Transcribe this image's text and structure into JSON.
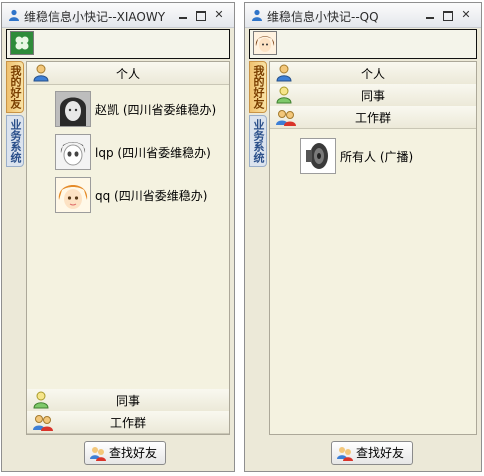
{
  "left_window": {
    "title": "维稳信息小快记--XIAOWY",
    "sidebar_tabs": [
      "我的好友",
      "业务系统"
    ],
    "groups": [
      {
        "label": "个人"
      },
      {
        "label": "同事"
      },
      {
        "label": "工作群"
      }
    ],
    "contacts": [
      {
        "name": "赵凯 (四川省委维稳办)"
      },
      {
        "name": "lqp (四川省委维稳办)"
      },
      {
        "name": "qq (四川省委维稳办)"
      }
    ],
    "find_button": "查找好友"
  },
  "right_window": {
    "title": "维稳信息小快记--QQ",
    "sidebar_tabs": [
      "我的好友",
      "业务系统"
    ],
    "groups": [
      {
        "label": "个人"
      },
      {
        "label": "同事"
      },
      {
        "label": "工作群"
      }
    ],
    "broadcast": {
      "name": "所有人 (广播)"
    },
    "find_button": "查找好友"
  }
}
